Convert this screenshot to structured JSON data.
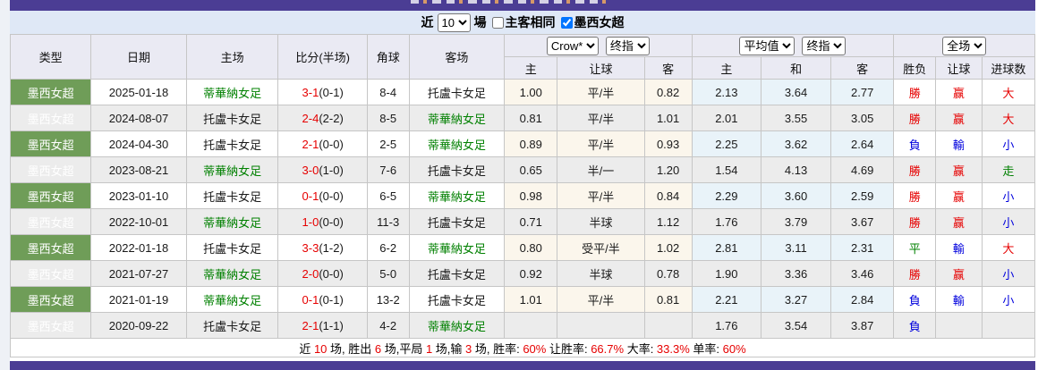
{
  "filter": {
    "near_label": "近",
    "count_value": "10",
    "matches_label": "場",
    "same_homeaway_label": "主客相同",
    "same_homeaway_checked": false,
    "league_label": "墨西女超",
    "league_checked": true
  },
  "table": {
    "left_headers": [
      "类型",
      "日期",
      "主场",
      "比分(半场)",
      "角球",
      "客场"
    ],
    "group1": {
      "select1": "Crow*",
      "select2": "终指",
      "cols": [
        "主",
        "让球",
        "客"
      ]
    },
    "group2": {
      "select1": "平均值",
      "select2": "终指",
      "cols": [
        "主",
        "和",
        "客"
      ]
    },
    "group3": {
      "select1": "全场",
      "cols": [
        "胜负",
        "让球",
        "进球数"
      ]
    },
    "rows": [
      {
        "league": "墨西女超",
        "date": "2025-01-18",
        "home": "蒂華納女足",
        "home_green": true,
        "score": "3-1",
        "half": "(0-1)",
        "corners": "8-4",
        "away": "托盧卡女足",
        "away_green": false,
        "ah_home": "1.00",
        "ah_line": "平/半",
        "ah_away": "0.82",
        "avg_home": "2.13",
        "avg_draw": "3.64",
        "avg_away": "2.77",
        "res_wdl": "勝",
        "res_wdl_color": "red",
        "res_ah": "赢",
        "res_ah_color": "red",
        "res_ou": "大",
        "res_ou_color": "red"
      },
      {
        "league": "墨西女超",
        "date": "2024-08-07",
        "home": "托盧卡女足",
        "home_green": false,
        "score": "2-4",
        "half": "(2-2)",
        "corners": "8-5",
        "away": "蒂華納女足",
        "away_green": true,
        "ah_home": "0.81",
        "ah_line": "平/半",
        "ah_away": "1.01",
        "avg_home": "2.01",
        "avg_draw": "3.55",
        "avg_away": "3.05",
        "res_wdl": "勝",
        "res_wdl_color": "red",
        "res_ah": "赢",
        "res_ah_color": "red",
        "res_ou": "大",
        "res_ou_color": "red"
      },
      {
        "league": "墨西女超",
        "date": "2024-04-30",
        "home": "托盧卡女足",
        "home_green": false,
        "score": "2-1",
        "half": "(0-0)",
        "corners": "2-5",
        "away": "蒂華納女足",
        "away_green": true,
        "ah_home": "0.89",
        "ah_line": "平/半",
        "ah_away": "0.93",
        "avg_home": "2.25",
        "avg_draw": "3.62",
        "avg_away": "2.64",
        "res_wdl": "負",
        "res_wdl_color": "blue",
        "res_ah": "輸",
        "res_ah_color": "blue",
        "res_ou": "小",
        "res_ou_color": "blue"
      },
      {
        "league": "墨西女超",
        "date": "2023-08-21",
        "home": "蒂華納女足",
        "home_green": true,
        "score": "3-0",
        "half": "(1-0)",
        "corners": "7-6",
        "away": "托盧卡女足",
        "away_green": false,
        "ah_home": "0.65",
        "ah_line": "半/一",
        "ah_away": "1.20",
        "avg_home": "1.54",
        "avg_draw": "4.13",
        "avg_away": "4.69",
        "res_wdl": "勝",
        "res_wdl_color": "red",
        "res_ah": "赢",
        "res_ah_color": "red",
        "res_ou": "走",
        "res_ou_color": "green"
      },
      {
        "league": "墨西女超",
        "date": "2023-01-10",
        "home": "托盧卡女足",
        "home_green": false,
        "score": "0-1",
        "half": "(0-0)",
        "corners": "6-5",
        "away": "蒂華納女足",
        "away_green": true,
        "ah_home": "0.98",
        "ah_line": "平/半",
        "ah_away": "0.84",
        "avg_home": "2.29",
        "avg_draw": "3.60",
        "avg_away": "2.59",
        "res_wdl": "勝",
        "res_wdl_color": "red",
        "res_ah": "赢",
        "res_ah_color": "red",
        "res_ou": "小",
        "res_ou_color": "blue"
      },
      {
        "league": "墨西女超",
        "date": "2022-10-01",
        "home": "蒂華納女足",
        "home_green": true,
        "score": "1-0",
        "half": "(0-0)",
        "corners": "11-3",
        "away": "托盧卡女足",
        "away_green": false,
        "ah_home": "0.71",
        "ah_line": "半球",
        "ah_away": "1.12",
        "avg_home": "1.76",
        "avg_draw": "3.79",
        "avg_away": "3.67",
        "res_wdl": "勝",
        "res_wdl_color": "red",
        "res_ah": "赢",
        "res_ah_color": "red",
        "res_ou": "小",
        "res_ou_color": "blue"
      },
      {
        "league": "墨西女超",
        "date": "2022-01-18",
        "home": "托盧卡女足",
        "home_green": false,
        "score": "3-3",
        "half": "(1-2)",
        "corners": "6-2",
        "away": "蒂華納女足",
        "away_green": true,
        "ah_home": "0.80",
        "ah_line": "受平/半",
        "ah_away": "1.02",
        "avg_home": "2.81",
        "avg_draw": "3.11",
        "avg_away": "2.31",
        "res_wdl": "平",
        "res_wdl_color": "green",
        "res_ah": "輸",
        "res_ah_color": "blue",
        "res_ou": "大",
        "res_ou_color": "red"
      },
      {
        "league": "墨西女超",
        "date": "2021-07-27",
        "home": "蒂華納女足",
        "home_green": true,
        "score": "2-0",
        "half": "(0-0)",
        "corners": "5-0",
        "away": "托盧卡女足",
        "away_green": false,
        "ah_home": "0.92",
        "ah_line": "半球",
        "ah_away": "0.78",
        "avg_home": "1.90",
        "avg_draw": "3.36",
        "avg_away": "3.46",
        "res_wdl": "勝",
        "res_wdl_color": "red",
        "res_ah": "赢",
        "res_ah_color": "red",
        "res_ou": "小",
        "res_ou_color": "blue"
      },
      {
        "league": "墨西女超",
        "date": "2021-01-19",
        "home": "蒂華納女足",
        "home_green": true,
        "score": "0-1",
        "half": "(0-1)",
        "corners": "13-2",
        "away": "托盧卡女足",
        "away_green": false,
        "ah_home": "1.01",
        "ah_line": "平/半",
        "ah_away": "0.81",
        "avg_home": "2.21",
        "avg_draw": "3.27",
        "avg_away": "2.84",
        "res_wdl": "負",
        "res_wdl_color": "blue",
        "res_ah": "輸",
        "res_ah_color": "blue",
        "res_ou": "小",
        "res_ou_color": "blue"
      },
      {
        "league": "墨西女超",
        "date": "2020-09-22",
        "home": "托盧卡女足",
        "home_green": false,
        "score": "2-1",
        "half": "(1-1)",
        "corners": "4-2",
        "away": "蒂華納女足",
        "away_green": true,
        "ah_home": "",
        "ah_line": "",
        "ah_away": "",
        "avg_home": "1.76",
        "avg_draw": "3.54",
        "avg_away": "3.87",
        "res_wdl": "負",
        "res_wdl_color": "blue",
        "res_ah": "",
        "res_ah_color": "",
        "res_ou": "",
        "res_ou_color": ""
      }
    ]
  },
  "footer": {
    "segments": [
      {
        "text": "近 ",
        "color": "black"
      },
      {
        "text": "10",
        "color": "red"
      },
      {
        "text": " 场, 胜出 ",
        "color": "black"
      },
      {
        "text": "6",
        "color": "red"
      },
      {
        "text": " 场,平局 ",
        "color": "black"
      },
      {
        "text": "1",
        "color": "red"
      },
      {
        "text": " 场,输 ",
        "color": "black"
      },
      {
        "text": "3",
        "color": "red"
      },
      {
        "text": " 场, 胜率: ",
        "color": "black"
      },
      {
        "text": "60%",
        "color": "red"
      },
      {
        "text": " 让胜率: ",
        "color": "black"
      },
      {
        "text": "66.7%",
        "color": "red"
      },
      {
        "text": " 大率: ",
        "color": "black"
      },
      {
        "text": "33.3%",
        "color": "red"
      },
      {
        "text": " 单率: ",
        "color": "black"
      },
      {
        "text": "60%",
        "color": "red"
      }
    ]
  },
  "colors": {
    "accent_purple": "#4b3d94",
    "filter_bg": "#dfe8f6",
    "header_bg": "#eaeaf3",
    "league_green": "#6f9d58",
    "handicap_col_bg": "#fbf6ec",
    "average_col_bg": "#e9f3f9",
    "win_red": "#e60000",
    "lose_blue": "#0000dd",
    "draw_green": "#008000",
    "stripe_gray": "#ececec"
  }
}
